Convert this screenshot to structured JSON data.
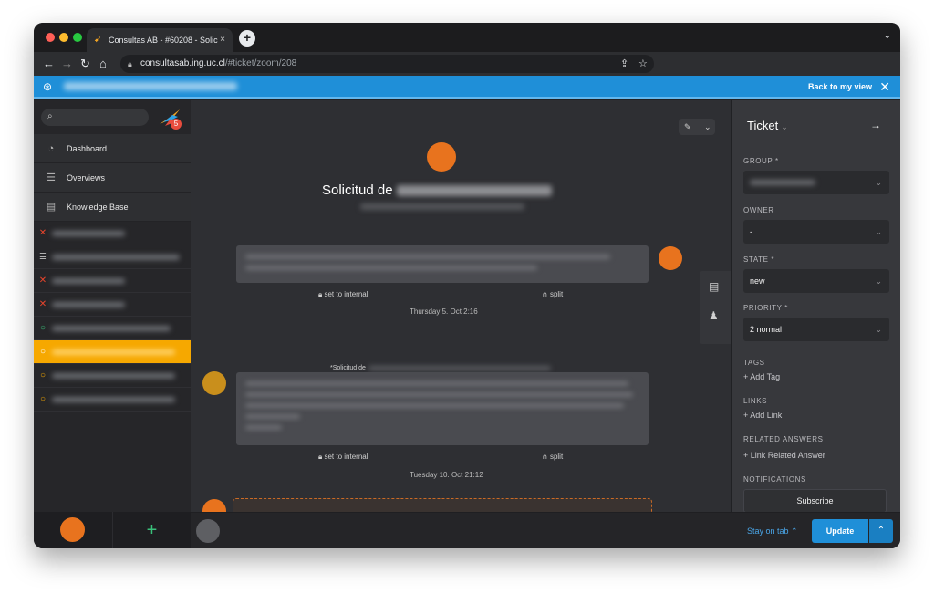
{
  "browser": {
    "tab_title": "Consultas AB - #60208 - Solic",
    "tab_close": "×",
    "new_tab": "+",
    "tab_menu": "⌄",
    "url_host": "consultasab.ing.uc.cl",
    "url_path": "/#ticket/zoom/208",
    "back_icon": "←",
    "forward_icon": "→",
    "reload_icon": "↻",
    "home_icon": "⌂",
    "share_icon": "⇪",
    "star_icon": "☆"
  },
  "banner": {
    "back_label": "Back to my view",
    "close_label": "✕"
  },
  "sidebar": {
    "badge_count": "5",
    "nav": [
      {
        "label": "Dashboard",
        "icon": "◔"
      },
      {
        "label": "Overviews",
        "icon": "☰"
      },
      {
        "label": "Knowledge Base",
        "icon": "▤"
      }
    ],
    "add_label": "+"
  },
  "ticket": {
    "title_prefix": "Solicitud de",
    "set_internal_label": "set to internal",
    "split_label": "split",
    "date_1": "Thursday 5. Oct 2:16",
    "system_msg_prefix": "*Solicitud de",
    "date_2": "Tuesday 10. Oct 21:12"
  },
  "bottom": {
    "stay_label": "Stay on tab",
    "update_label": "Update"
  },
  "attributes": {
    "header": "Ticket",
    "group_label": "GROUP *",
    "owner_label": "OWNER",
    "owner_value": "-",
    "state_label": "STATE *",
    "state_value": "new",
    "priority_label": "PRIORITY *",
    "priority_value": "2 normal",
    "tags_label": "TAGS",
    "add_tag": "+ Add Tag",
    "links_label": "LINKS",
    "add_link": "+ Add Link",
    "related_label": "RELATED ANSWERS",
    "add_related": "+ Link Related Answer",
    "notifications_label": "NOTIFICATIONS",
    "subscribe_label": "Subscribe"
  },
  "colors": {
    "accent_blue": "#1f8fd8",
    "active_tab": "#f6a800",
    "avatar_orange": "#e8731e",
    "close_red": "#e8452c",
    "open_green": "#39c07a"
  }
}
